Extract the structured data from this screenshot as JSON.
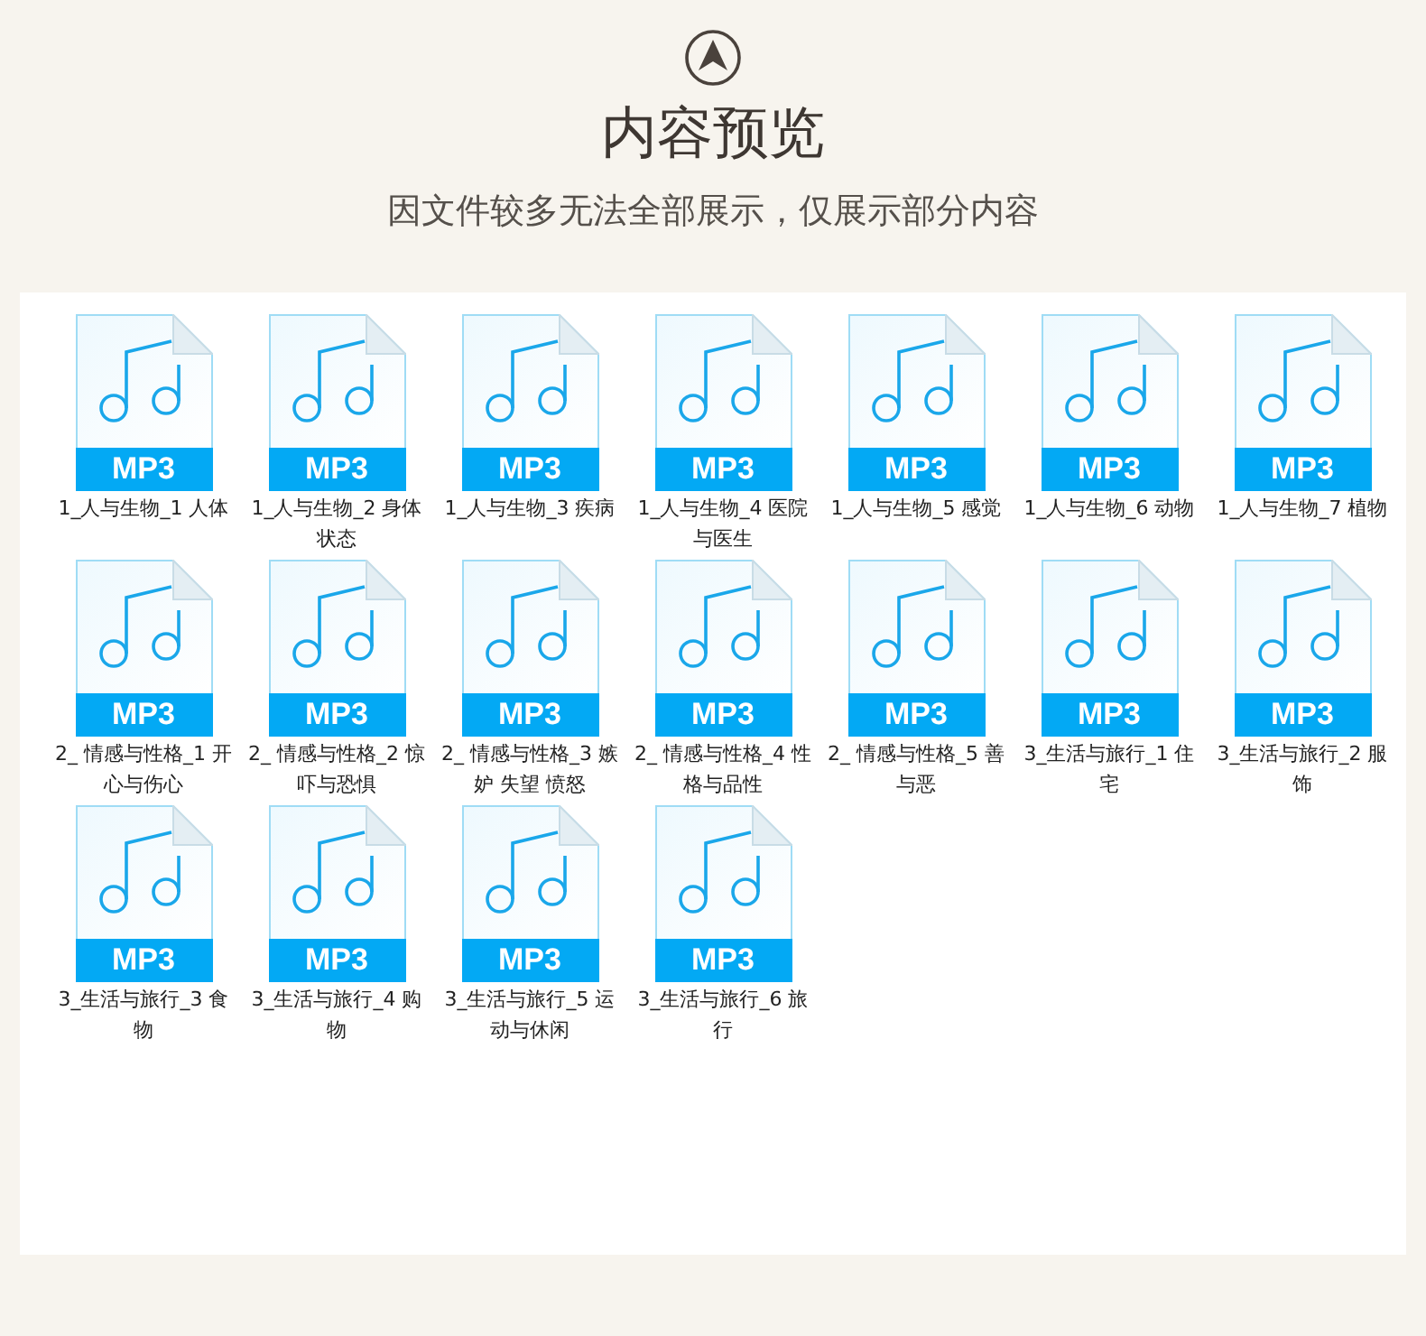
{
  "header": {
    "title": "内容预览",
    "subtitle": "因文件较多无法全部展示，仅展示部分内容"
  },
  "files": [
    {
      "badge": "MP3",
      "name": "1_人与生物_1 人体"
    },
    {
      "badge": "MP3",
      "name": "1_人与生物_2 身体状态"
    },
    {
      "badge": "MP3",
      "name": "1_人与生物_3 疾病"
    },
    {
      "badge": "MP3",
      "name": "1_人与生物_4 医院与医生"
    },
    {
      "badge": "MP3",
      "name": "1_人与生物_5 感觉"
    },
    {
      "badge": "MP3",
      "name": "1_人与生物_6 动物"
    },
    {
      "badge": "MP3",
      "name": "1_人与生物_7 植物"
    },
    {
      "badge": "MP3",
      "name": "2_ 情感与性格_1 开心与伤心"
    },
    {
      "badge": "MP3",
      "name": "2_ 情感与性格_2 惊吓与恐惧"
    },
    {
      "badge": "MP3",
      "name": "2_ 情感与性格_3 嫉妒 失望 愤怒"
    },
    {
      "badge": "MP3",
      "name": "2_ 情感与性格_4 性格与品性"
    },
    {
      "badge": "MP3",
      "name": "2_ 情感与性格_5 善与恶"
    },
    {
      "badge": "MP3",
      "name": "3_生活与旅行_1 住宅"
    },
    {
      "badge": "MP3",
      "name": "3_生活与旅行_2 服饰"
    },
    {
      "badge": "MP3",
      "name": "3_生活与旅行_3 食物"
    },
    {
      "badge": "MP3",
      "name": "3_生活与旅行_4 购物"
    },
    {
      "badge": "MP3",
      "name": "3_生活与旅行_5 运动与休闲"
    },
    {
      "badge": "MP3",
      "name": "3_生活与旅行_6 旅行"
    }
  ]
}
